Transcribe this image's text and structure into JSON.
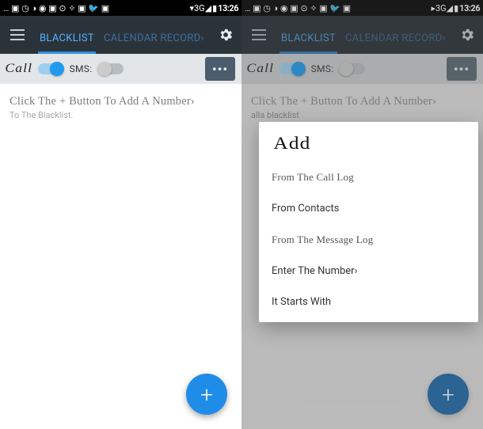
{
  "statusbar": {
    "left_icons": "… ▣ ◷ ◑ ◉ ▣ ⊙ ✧ ▣ 🐦 ▣",
    "right_network_left": "▾3G◢",
    "right_network_right": "▸3G◢",
    "battery": "▮",
    "time": "13:26"
  },
  "toolbar": {
    "tab_active": "BLACKLIST",
    "tab_rest": "CALENDAR RECORD›"
  },
  "filterbar": {
    "call_label": "Call",
    "sms_label": "SMS:",
    "more_label": "•••"
  },
  "hint": {
    "title": "Click The + Button To Add A Number›",
    "sub_left": "To The Blacklist.",
    "sub_right": "alla blacklist"
  },
  "fab": {
    "label": "+"
  },
  "sheet": {
    "title": "Add",
    "items": [
      "From The Call Log",
      "From Contacts",
      "From The Message Log",
      "Enter The Number›",
      "It Starts With"
    ]
  }
}
